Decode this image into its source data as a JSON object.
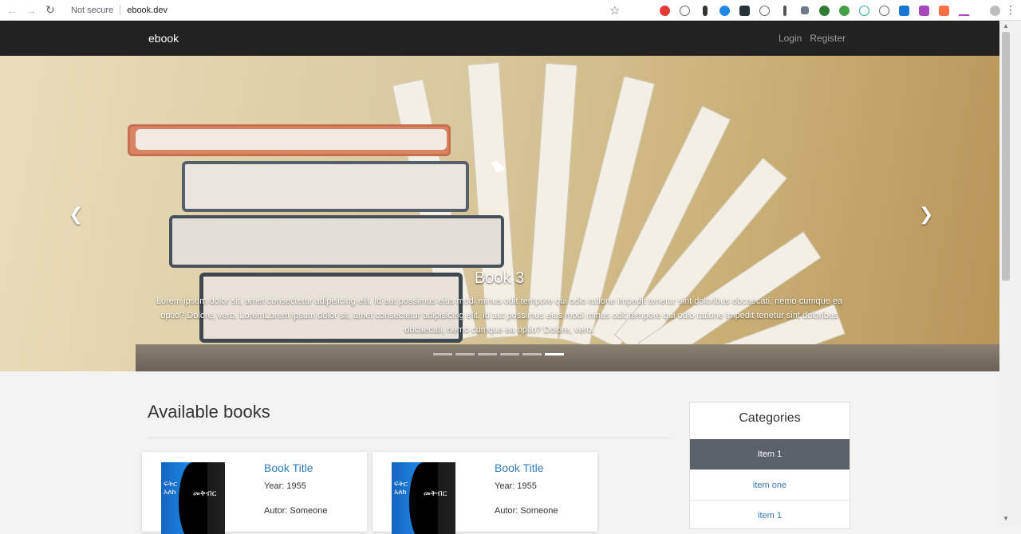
{
  "browser": {
    "security_label": "Not secure",
    "url": "ebook.dev"
  },
  "navbar": {
    "brand": "ebook",
    "login": "Login",
    "register": "Register"
  },
  "carousel": {
    "caption_title": "Book 3",
    "caption_text": "Lorem ipsum dolor sit, amet consectetur adipisicing elit. Id aut possimus eius modi minus odit tempore qui odio ratione impedit tenetur sint doloribus obcaecati, nemo cumque ea optio? Dolore, vero. LoremLorem ipsum dolor sit, amet consectetur adipisicing elit. Id aut possimus eius modi minus odit tempore qui odio ratione impedit tenetur sint doloribus obcaecati, nemo cumque ea optio? Dolore, vero.",
    "prev_icon": "chevron-left-icon",
    "next_icon": "chevron-right-icon",
    "slide_count": 6,
    "active_slide": 6
  },
  "main": {
    "section_title": "Available books",
    "books": [
      {
        "title": "Book Title",
        "year": "Year: 1955",
        "author": "Autor: Someone",
        "cover_text_left": "ፍትር\nአለክ",
        "cover_text_right": "መቅብር"
      },
      {
        "title": "Book Title",
        "year": "Year: 1955",
        "author": "Autor: Someone",
        "cover_text_left": "ፍትር\nአለክ",
        "cover_text_right": "መቅብር"
      }
    ]
  },
  "sidebar": {
    "title": "Categories",
    "items": [
      {
        "label": "Item 1",
        "active": true
      },
      {
        "label": "item one",
        "active": false
      },
      {
        "label": "item 1",
        "active": false
      }
    ]
  },
  "colors": {
    "navbar_bg": "#222222",
    "link": "#337ab7",
    "active_category": "#5a6169"
  }
}
